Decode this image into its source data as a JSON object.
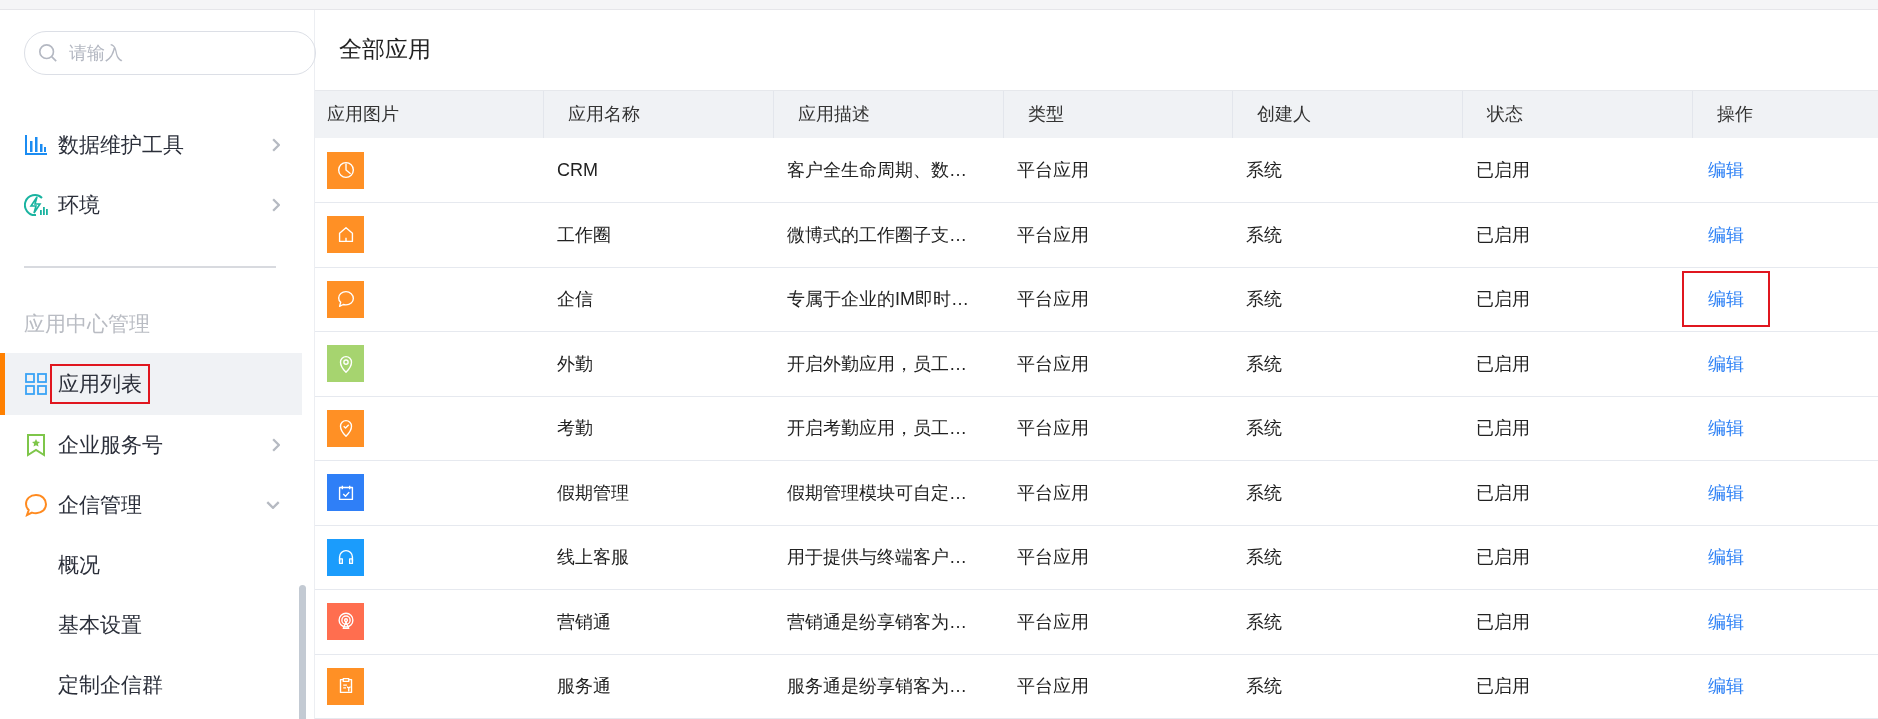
{
  "sidebar": {
    "search": {
      "placeholder": "请输入"
    },
    "groups": [
      {
        "items": [
          {
            "label": "数据维护工具",
            "kind": "bar-chart",
            "selected": false,
            "annotated": false,
            "expanded": false
          },
          {
            "label": "环境",
            "kind": "lightning",
            "selected": false,
            "annotated": false,
            "expanded": false
          }
        ]
      },
      {
        "title": "应用中心管理",
        "items": [
          {
            "label": "应用列表",
            "kind": "grid",
            "selected": true,
            "annotated": true
          },
          {
            "label": "企业服务号",
            "kind": "bookmark",
            "selected": false,
            "annotated": false,
            "expanded": false
          },
          {
            "label": "企信管理",
            "kind": "chat",
            "selected": false,
            "annotated": false,
            "expanded": true,
            "children": [
              {
                "label": "概况",
                "selected": false,
                "annotated": false
              },
              {
                "label": "基本设置",
                "selected": false,
                "annotated": false
              },
              {
                "label": "定制企信群",
                "selected": false,
                "annotated": false
              }
            ]
          }
        ]
      }
    ]
  },
  "page": {
    "title": "全部应用"
  },
  "table": {
    "columns": [
      "应用图片",
      "应用名称",
      "应用描述",
      "类型",
      "创建人",
      "状态",
      "操作"
    ],
    "rows": [
      {
        "kind": "pie",
        "color": "#ff9025",
        "name": "CRM",
        "description": "客户全生命周期、数…",
        "type": "平台应用",
        "creator": "系统",
        "status": "已启用",
        "action": "编辑",
        "annotated": false
      },
      {
        "kind": "house",
        "color": "#ff9025",
        "name": "工作圈",
        "description": "微博式的工作圈子支…",
        "type": "平台应用",
        "creator": "系统",
        "status": "已启用",
        "action": "编辑",
        "annotated": false
      },
      {
        "kind": "chat",
        "color": "#ff9025",
        "name": "企信",
        "description": "专属于企业的IM即时…",
        "type": "平台应用",
        "creator": "系统",
        "status": "已启用",
        "action": "编辑",
        "annotated": true
      },
      {
        "kind": "pin",
        "color": "#a6d46f",
        "name": "外勤",
        "description": "开启外勤应用，员工…",
        "type": "平台应用",
        "creator": "系统",
        "status": "已启用",
        "action": "编辑",
        "annotated": false
      },
      {
        "kind": "pin-check",
        "color": "#ff9025",
        "name": "考勤",
        "description": "开启考勤应用，员工…",
        "type": "平台应用",
        "creator": "系统",
        "status": "已启用",
        "action": "编辑",
        "annotated": false
      },
      {
        "kind": "calendar",
        "color": "#2f7ff7",
        "name": "假期管理",
        "description": "假期管理模块可自定…",
        "type": "平台应用",
        "creator": "系统",
        "status": "已启用",
        "action": "编辑",
        "annotated": false
      },
      {
        "kind": "headset",
        "color": "#1b9cfc",
        "name": "线上客服",
        "description": "用于提供与终端客户…",
        "type": "平台应用",
        "creator": "系统",
        "status": "已启用",
        "action": "编辑",
        "annotated": false
      },
      {
        "kind": "broadcast",
        "color": "#ff6e4f",
        "name": "营销通",
        "description": "营销通是纷享销客为…",
        "type": "平台应用",
        "creator": "系统",
        "status": "已启用",
        "action": "编辑",
        "annotated": false
      },
      {
        "kind": "clipboard",
        "color": "#ff9025",
        "name": "服务通",
        "description": "服务通是纷享销客为…",
        "type": "平台应用",
        "creator": "系统",
        "status": "已启用",
        "action": "编辑",
        "annotated": false
      }
    ]
  }
}
